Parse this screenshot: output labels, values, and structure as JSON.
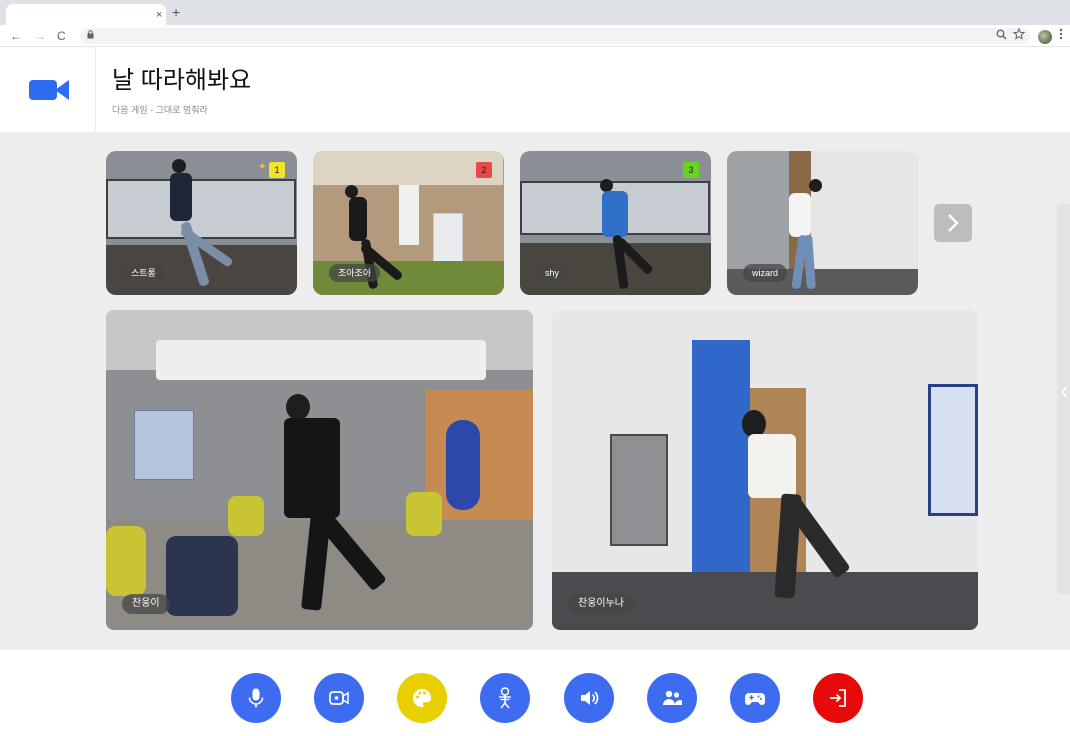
{
  "browser": {
    "tab_close_glyph": "×",
    "new_tab_glyph": "+",
    "nav": {
      "back_glyph": "←",
      "forward_glyph": "→",
      "reload_glyph": "C"
    },
    "icons": [
      "lock-icon",
      "search-icon",
      "star-icon",
      "profile-avatar",
      "menu-icon"
    ]
  },
  "header": {
    "title": "날 따라해봐요",
    "subtitle": "다음 게임 - 그대로 멈춰라",
    "logo_icon": "video-camera-icon",
    "brand_color": "#2d6cf0"
  },
  "participants": [
    {
      "name": "스트롱",
      "rank": "1",
      "rank_color": "#f3e32a",
      "celebration_icon": "party-popper-icon"
    },
    {
      "name": "조아조아",
      "rank": "2",
      "rank_color": "#e84848"
    },
    {
      "name": "shy",
      "rank": "3",
      "rank_color": "#66d61a"
    },
    {
      "name": "wizard"
    }
  ],
  "next_icon": "chevron-right-icon",
  "main_videos": [
    {
      "name": "찬웅이"
    },
    {
      "name": "찬웅이누나"
    }
  ],
  "controls": [
    {
      "name": "mic",
      "icon": "microphone-icon",
      "color": "#3d6cf0"
    },
    {
      "name": "camera",
      "icon": "camera-icon",
      "color": "#3d6cf0"
    },
    {
      "name": "palette",
      "icon": "palette-icon",
      "color": "#e8cf00"
    },
    {
      "name": "skeleton",
      "icon": "skeleton-icon",
      "color": "#3d6cf0"
    },
    {
      "name": "volume",
      "icon": "speaker-icon",
      "color": "#3d6cf0"
    },
    {
      "name": "participants",
      "icon": "users-icon",
      "color": "#3d6cf0"
    },
    {
      "name": "game",
      "icon": "gamepad-icon",
      "color": "#3d6cf0"
    },
    {
      "name": "leave",
      "icon": "exit-icon",
      "color": "#e80a0a"
    }
  ]
}
